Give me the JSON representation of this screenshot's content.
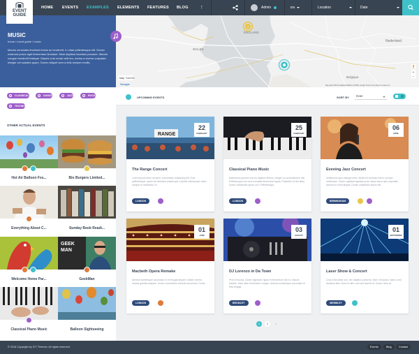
{
  "brand": {
    "line1": "EVENT",
    "line2": "GUIDE"
  },
  "nav": {
    "items": [
      "HOME",
      "EVENTS",
      "EXAMPLES",
      "ELEMENTS",
      "FEATURES",
      "BLOG"
    ],
    "active": "EXAMPLES",
    "more": "⋮",
    "user": "Admin",
    "lang": "EN",
    "location_placeholder": "Location",
    "date_placeholder": "Date"
  },
  "hero": {
    "title": "MUSIC",
    "crumb": "home / event guide / music",
    "desc": "Mauris venenatis tincidunt lectus ac hendrerit. In vitae pellentesque elit. Donec euismod purus eget fermentum tincidunt. Nam dapibus faucibus posuere. Mauris congue hendrerit tristique. Mauris cum modo velit leo, metus a viverra vulputate. Integer vel sodales quam. Donec aliquet sem a felis semper mollis."
  },
  "tags": [
    "CLASSICAL",
    "DANCE",
    "JAZZ",
    "ROCK",
    "TECHNO"
  ],
  "other_heading": "OTHER ACTUAL EVENTS",
  "side_events": [
    "Hot Air Balloon Fes...",
    "Bio Burgers Limited...",
    "Everything About C...",
    "Sunday Book Readi...",
    "Welcome Home Par...",
    "GeekMan",
    "Classical Piano Music",
    "Balloon Sightseeing"
  ],
  "map": {
    "labels": [
      "ENGLAND",
      "WALES",
      "Nederland",
      "Belgique"
    ],
    "controls": [
      "Map",
      "Satellite"
    ],
    "attrib": "Map data ©2016 GeoBasis-DE/BKG (©2009), Google   Terms of Use   Report a map error"
  },
  "filter": {
    "upcoming": "UPCOMING EVENTS",
    "sort_label": "SORT BY",
    "sort_value": "Date"
  },
  "events": [
    {
      "day": "22",
      "month": "FEBRUARY",
      "title": "The Range Concert",
      "desc": "Lorem ipsum dolor sit amet, consectetur adipiscing elit. Duis pellentesque, quam vel tincidunt scelerisque, lobortis ullamcorper dolor semper et venenatis. Et",
      "city": "LONDON"
    },
    {
      "day": "25",
      "month": "FEBRUARY",
      "title": "Classical Piano Music",
      "desc": "Maecenas posuere orci eu dapibus finibus. Integer eu condimentum nisi. Pellentesque non sem convallis fermentum ligula. Phasellus id nisi diam. Donec sollicitudin ipsum orci. Pellentesque.",
      "city": "LONDON"
    },
    {
      "day": "06",
      "month": "APRIL",
      "title": "Evening Jazz Concert",
      "desc": "Vestibulum quis tristique enim. Nulla vel vehicula lorem, semper vestibulum. Donec egestas egestas proin luctus lacus quis vulputate. Aenean in enim aliquet. Donec sollicitudin ipsum elit.",
      "city": "BIRMINGHAM"
    },
    {
      "day": "01",
      "month": "JUNE",
      "title": "Macbeth Opera Remake",
      "desc": "Aenean scelerisque accumsan ex et feugiat aliquet. Nullam viverra mauris gravida aliquam. Donec consectetur lobortis accumsan. Donec",
      "city": "LONDON"
    },
    {
      "day": "03",
      "month": "AUGUST",
      "title": "DJ Lorenzo in Da Town",
      "desc": "Proin id luctus. Donec dignissim ligula et fermentum nisl eu. Mauris lobortis, risus vitae fermentum congue. Aenean scelerisque accumsan et felis feugiat.",
      "city": "BROMLEY"
    },
    {
      "day": "01",
      "month": "SEPTEMBER",
      "title": "Laser Show & Concert",
      "desc": "Cras id tincidunt orci, nec dapibus porta est. Nam vel ipsum. Nam a sed faucibus felis. Nunc id nibh, sed sed laoreet et. Donec risus at.",
      "city": "WEMBLEY"
    }
  ],
  "pagination": {
    "pages": [
      "1",
      "2"
    ],
    "next": "›"
  },
  "footer": {
    "copy": "© 2016 Copyright by ICT Themes. All rights reserved.",
    "links": [
      "Events",
      "Blog",
      "Contact"
    ]
  },
  "colors": {
    "nav": "#394452",
    "accent": "#3fc1c9",
    "hero": "#3b5f9c",
    "purple": "#9d5fc8",
    "city": "#2f4a7a"
  }
}
